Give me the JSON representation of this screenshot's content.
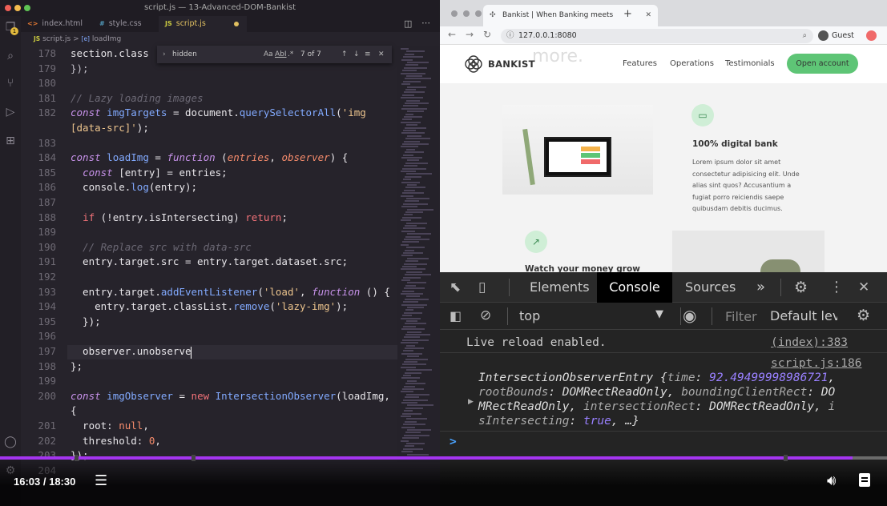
{
  "editor": {
    "window_title": "script.js — 13-Advanced-DOM-Bankist",
    "tabs": [
      {
        "icon": "<>",
        "label": "index.html"
      },
      {
        "icon": "#",
        "label": "style.css"
      },
      {
        "icon": "JS",
        "label": "script.js"
      }
    ],
    "breadcrumb_file": "script.js",
    "breadcrumb_sep": ">",
    "breadcrumb_symbol": "loadImg",
    "breadcrumb_icon": "JS",
    "breadcrumb_symbol_icon": "[e]",
    "find": {
      "query": "hidden",
      "match_case": "Aa",
      "whole_word": "AbI",
      "regex": ".*",
      "count": "7 of 7"
    },
    "badge": "1",
    "lines": [
      {
        "n": "178",
        "html": "section.class"
      },
      {
        "n": "179",
        "html": "<span class=\"pu\">});</span>"
      },
      {
        "n": "180",
        "html": ""
      },
      {
        "n": "181",
        "html": "<span class=\"c\">// Lazy loading images</span>"
      },
      {
        "n": "182",
        "html": "<span class=\"k\">const</span> <span class=\"f\">imgTargets</span> = document.<span class=\"f\">querySelectorAll</span>(<span class=\"s\">'img</span>"
      },
      {
        "n": "",
        "html": "<span class=\"s\">[data-src]'</span>);"
      },
      {
        "n": "183",
        "html": ""
      },
      {
        "n": "184",
        "html": "<span class=\"k\">const</span> <span class=\"f\">loadImg</span> = <span class=\"k\">function</span> (<span class=\"p\">entries</span>, <span class=\"p\">observer</span>) {"
      },
      {
        "n": "185",
        "html": "  <span class=\"k\">const</span> [entry] = entries;"
      },
      {
        "n": "186",
        "html": "  console.<span class=\"f\">log</span>(entry);"
      },
      {
        "n": "187",
        "html": ""
      },
      {
        "n": "188",
        "html": "  <span class=\"k2\">if</span> (!entry.isIntersecting) <span class=\"k2\">return</span>;"
      },
      {
        "n": "189",
        "html": ""
      },
      {
        "n": "190",
        "html": "  <span class=\"c\">// Replace src with data-src</span>"
      },
      {
        "n": "191",
        "html": "  entry.target.src = entry.target.dataset.src;"
      },
      {
        "n": "192",
        "html": ""
      },
      {
        "n": "193",
        "html": "  entry.target.<span class=\"f\">addEventListener</span>(<span class=\"s\">'load'</span>, <span class=\"k\">function</span> () {"
      },
      {
        "n": "194",
        "html": "    entry.target.classList.<span class=\"f\">remove</span>(<span class=\"s\">'lazy-img'</span>);"
      },
      {
        "n": "195",
        "html": "  });"
      },
      {
        "n": "196",
        "html": ""
      },
      {
        "n": "197",
        "html": "  observer.unobserve"
      },
      {
        "n": "198",
        "html": "};"
      },
      {
        "n": "199",
        "html": ""
      },
      {
        "n": "200",
        "html": "<span class=\"k\">const</span> <span class=\"f\">imgObserver</span> = <span class=\"k2\">new</span> <span class=\"f\">IntersectionObserver</span>(loadImg,"
      },
      {
        "n": "",
        "html": "{"
      },
      {
        "n": "201",
        "html": "  root: <span class=\"n\">null</span>,"
      },
      {
        "n": "202",
        "html": "  threshold: <span class=\"n\">0</span>,"
      },
      {
        "n": "203",
        "html": "});"
      },
      {
        "n": "204",
        "html": ""
      }
    ]
  },
  "browser": {
    "tab_title": "Bankist | When Banking meets",
    "url": "127.0.0.1:8080",
    "profile": "Guest",
    "site": {
      "logo": "BANKIST",
      "nav": [
        "Features",
        "Operations",
        "Testimonials"
      ],
      "cta": "Open account",
      "hero_fragment": "more.",
      "feature1_title": "100% digital bank",
      "feature1_text": [
        "Lorem ipsum dolor sit amet",
        "consectetur adipisicing elit. Unde",
        "alias sint quos? Accusantium a",
        "fugiat porro reiciendis saepe",
        "quibusdam debitis ducimus."
      ],
      "feature2_title": "Watch your money grow"
    }
  },
  "devtools": {
    "tabs": [
      "Elements",
      "Console",
      "Sources"
    ],
    "active_tab": "Console",
    "context": "top",
    "filter_placeholder": "Filter",
    "levels": "Default leve",
    "messages": [
      {
        "text": "Live reload enabled.",
        "source": "(index):383"
      },
      {
        "source": "script.js:186"
      }
    ],
    "entry": {
      "class": "IntersectionObserverEntry",
      "time_key": "time",
      "time_val": "92.49499998986721",
      "rootBounds_key": "rootBounds",
      "rootBounds_val": "DOMRectReadOnly",
      "bcr_key": "boundingClientRect",
      "bcr_val_a": "DO",
      "bcr_val_b": "MRectReadOnly",
      "ir_key": "intersectionRect",
      "ir_val": "DOMRectReadOnly",
      "is_key_a": "i",
      "is_key_b": "sIntersecting",
      "is_val": "true",
      "ellipsis": "…}"
    },
    "prompt": ">"
  },
  "player": {
    "current_time": "16:03",
    "duration": "18:30",
    "time_display": "16:03 / 18:30",
    "progress": 0.961
  },
  "colors": {
    "accent_purple": "#a435f0",
    "bankist_green": "#5ec576",
    "console_active_bg": "#000000"
  }
}
